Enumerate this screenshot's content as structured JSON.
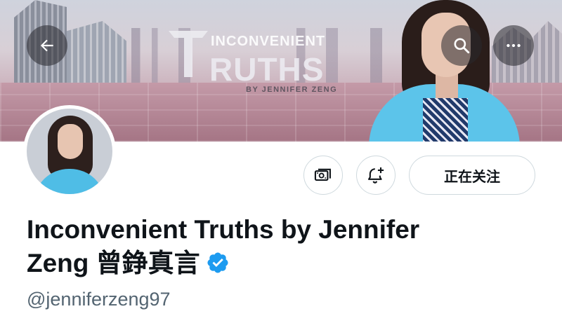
{
  "header": {
    "back_icon": "arrow-left-icon",
    "search_icon": "search-icon",
    "more_icon": "more-horizontal-icon"
  },
  "banner": {
    "logo_line1": "INCONVENIENT",
    "logo_line2": "RUTHS",
    "logo_line3": "BY JENNIFER ZENG"
  },
  "actions": {
    "subscribe_icon": "subscription-icon",
    "notify_icon": "bell-plus-icon",
    "follow_label": "正在关注"
  },
  "profile": {
    "name_line1": "Inconvenient Truths by Jennifer",
    "name_line2": "Zeng 曾錚真言",
    "handle": "@jenniferzeng97",
    "verified_icon": "verified-badge-icon"
  },
  "colors": {
    "accent": "#1d9bf0",
    "text": "#0f1419",
    "muted": "#536471",
    "border": "#cfd9de"
  }
}
